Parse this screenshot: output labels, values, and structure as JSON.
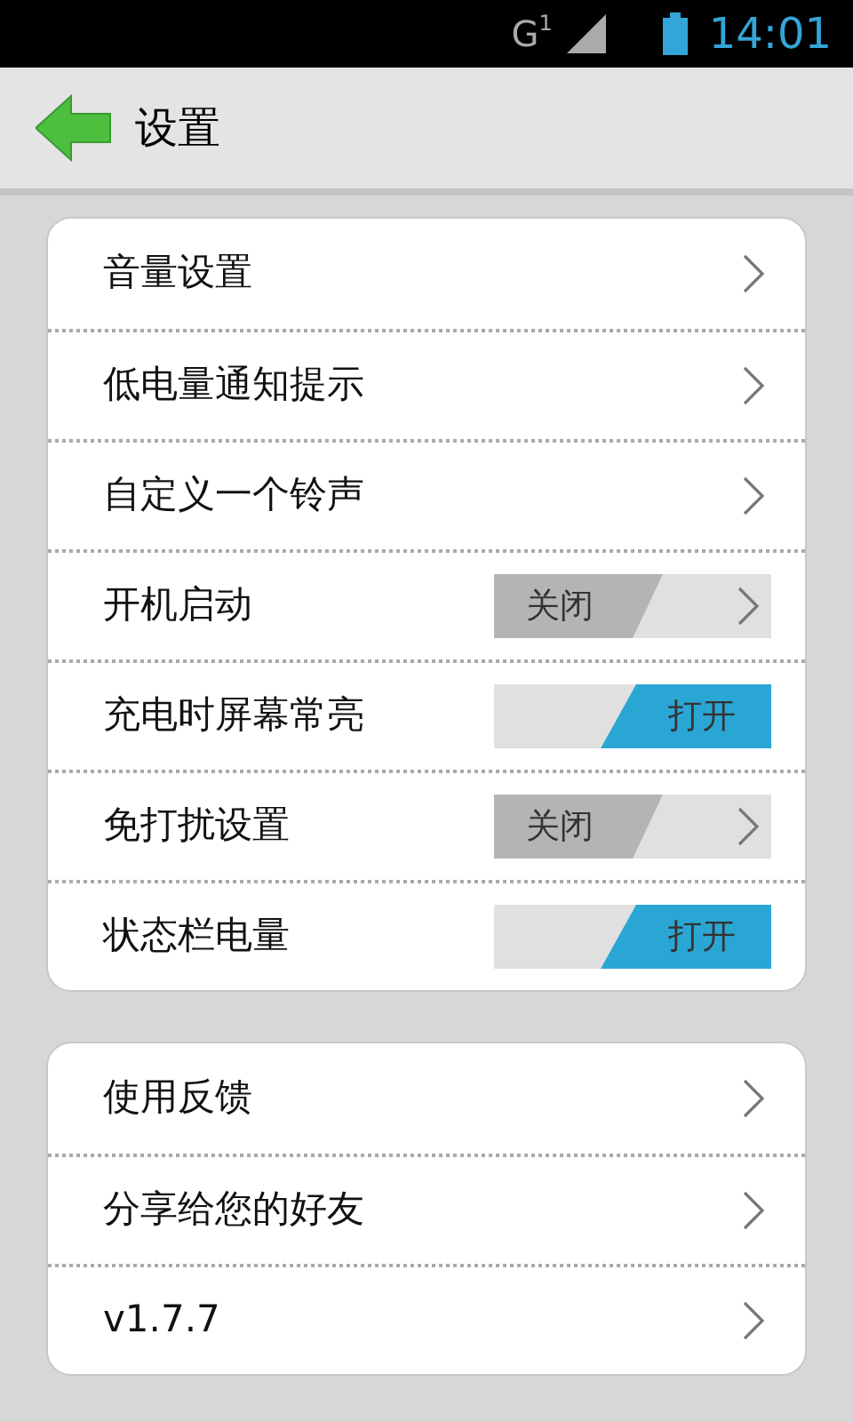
{
  "status_bar": {
    "network": "G",
    "sim": "1",
    "time": "14:01"
  },
  "header": {
    "title": "设置"
  },
  "groups": [
    {
      "items": [
        {
          "kind": "link",
          "label": "音量设置"
        },
        {
          "kind": "link",
          "label": "低电量通知提示"
        },
        {
          "kind": "link",
          "label": "自定义一个铃声"
        },
        {
          "kind": "toggle",
          "label": "开机启动",
          "on": false,
          "state_text": "关闭"
        },
        {
          "kind": "toggle",
          "label": "充电时屏幕常亮",
          "on": true,
          "state_text": "打开"
        },
        {
          "kind": "toggle",
          "label": "免打扰设置",
          "on": false,
          "state_text": "关闭"
        },
        {
          "kind": "toggle",
          "label": "状态栏电量",
          "on": true,
          "state_text": "打开"
        }
      ]
    },
    {
      "items": [
        {
          "kind": "link",
          "label": "使用反馈"
        },
        {
          "kind": "link",
          "label": "分享给您的好友"
        },
        {
          "kind": "link",
          "label": "v1.7.7"
        }
      ]
    }
  ]
}
